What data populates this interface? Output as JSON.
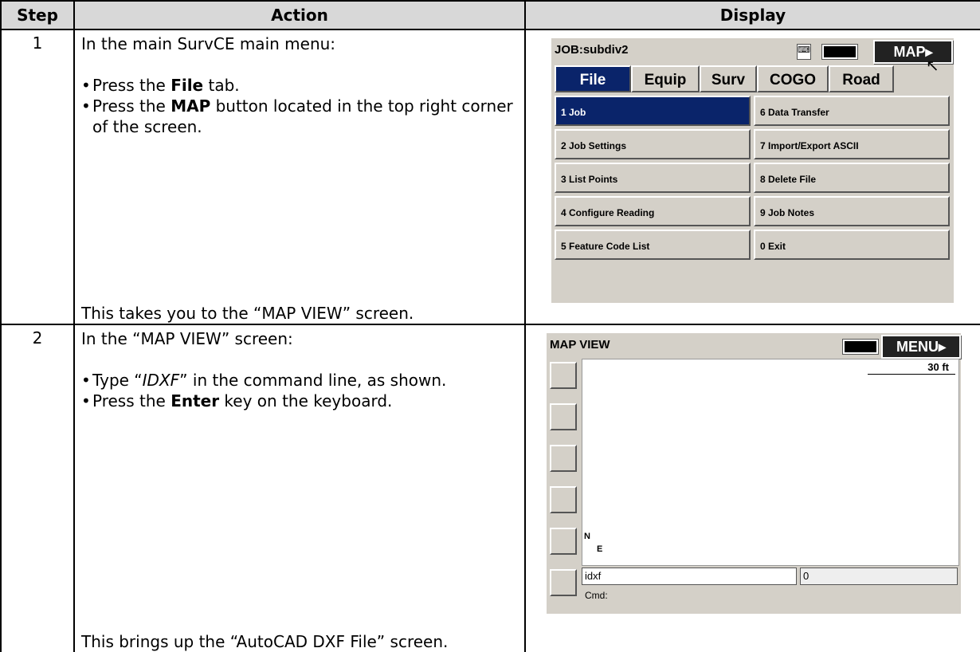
{
  "headers": {
    "step": "Step",
    "action": "Action",
    "display": "Display"
  },
  "row1": {
    "step": "1",
    "intro": "In the main SurvCE main menu:",
    "bullet1_pre": "Press the ",
    "bullet1_bold": "File",
    "bullet1_post": " tab.",
    "bullet2_pre": "Press the ",
    "bullet2_bold": "MAP",
    "bullet2_post": " button located in the top right corner of the screen.",
    "outro": "This takes you to the “MAP VIEW” screen.",
    "screen": {
      "title": "JOB:subdiv2",
      "map_button": "MAP▸",
      "tabs": [
        "File",
        "Equip",
        "Surv",
        "COGO",
        "Road"
      ],
      "active_tab": "File",
      "menu_left": [
        "1 Job",
        "2 Job Settings",
        "3 List Points",
        "4 Configure Reading",
        "5 Feature Code List"
      ],
      "menu_right": [
        "6 Data Transfer",
        "7 Import/Export ASCII",
        "8 Delete File",
        "9 Job Notes",
        "0 Exit"
      ]
    }
  },
  "row2": {
    "step": "2",
    "intro": "In the “MAP VIEW” screen:",
    "bullet1_pre": "Type “",
    "bullet1_ital": "IDXF",
    "bullet1_post": "” in the command line, as shown.",
    "bullet2_pre": "Press the ",
    "bullet2_bold": "Enter",
    "bullet2_post": " key on the keyboard.",
    "outro": "This brings up the “AutoCAD DXF File” screen.",
    "screen": {
      "title": "MAP VIEW",
      "menu_button": "MENU▸",
      "scale": "30 ft",
      "command_value": "idxf",
      "coord_value": "0",
      "cmd_label": "Cmd:",
      "north_label": "N",
      "east_label": "E"
    }
  },
  "colors": {
    "header_bg": "#d8d8d8",
    "device_bg": "#d4d0c8",
    "selected_blue": "#0a246a"
  }
}
